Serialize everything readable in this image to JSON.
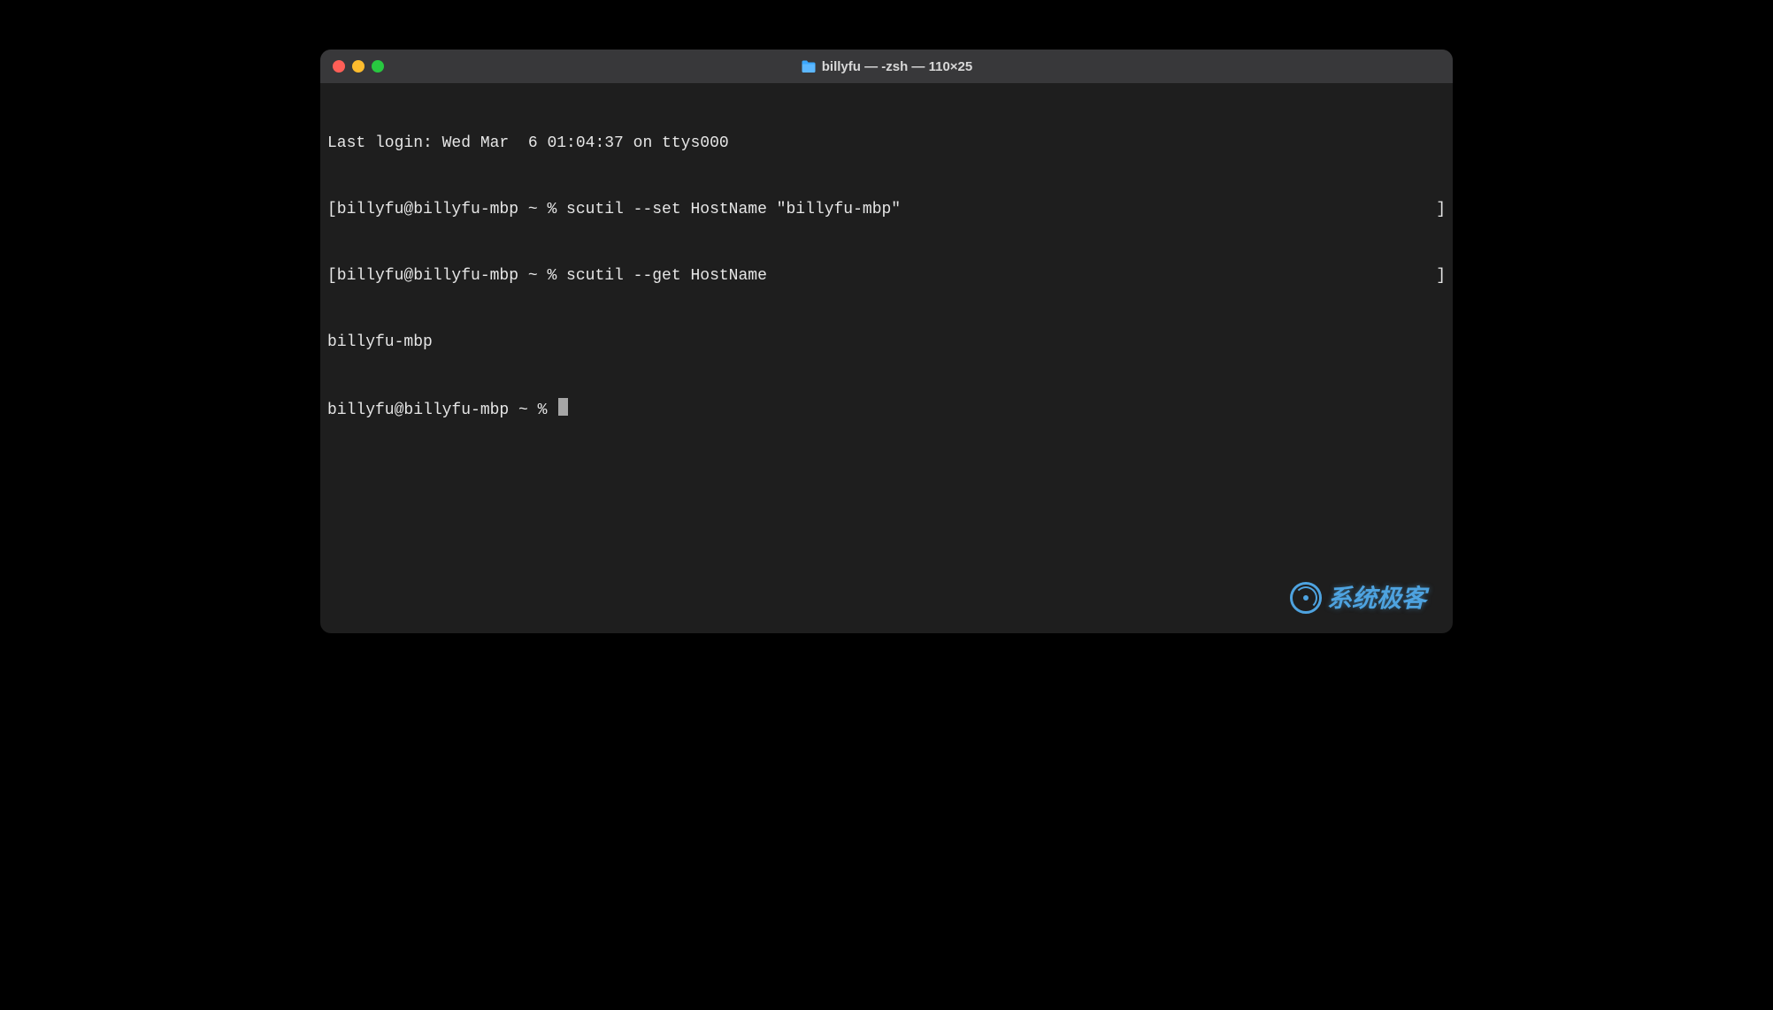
{
  "window": {
    "title": "billyfu — -zsh — 110×25"
  },
  "terminal": {
    "lines": [
      {
        "text": "Last login: Wed Mar  6 01:04:37 on ttys000",
        "bracket": false
      },
      {
        "text": "[billyfu@billyfu-mbp ~ % scutil --set HostName \"billyfu-mbp\"",
        "bracket": true
      },
      {
        "text": "[billyfu@billyfu-mbp ~ % scutil --get HostName",
        "bracket": true
      },
      {
        "text": "billyfu-mbp",
        "bracket": false
      },
      {
        "text": "billyfu@billyfu-mbp ~ % ",
        "bracket": false,
        "cursor": true
      }
    ]
  },
  "watermark": {
    "text": "系统极客"
  }
}
